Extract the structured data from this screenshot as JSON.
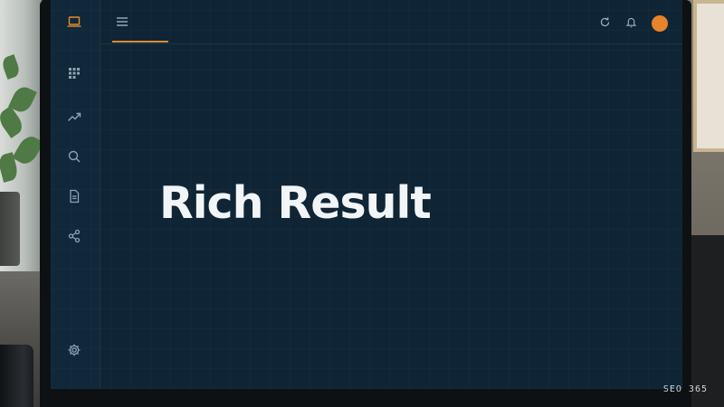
{
  "sidebar": {
    "logo_icon": "laptop-icon",
    "items": [
      {
        "name": "dashboard",
        "icon": "grid-icon"
      },
      {
        "name": "trends",
        "icon": "trending-up-icon"
      },
      {
        "name": "search",
        "icon": "search-icon"
      },
      {
        "name": "documents",
        "icon": "document-icon"
      },
      {
        "name": "share",
        "icon": "share-icon"
      }
    ],
    "settings_icon": "gear-icon"
  },
  "topbar": {
    "menu_icon": "hamburger-menu-icon",
    "right_icons": [
      "refresh-icon",
      "bell-icon"
    ],
    "avatar_color": "#e7832a"
  },
  "main": {
    "headline": "Rich Result"
  },
  "watermark": "SEO 365",
  "colors": {
    "accent": "#e08a2c",
    "screen_bg": "#0f2535",
    "sidebar_bg": "#10283a",
    "text": "#f2f5f7"
  }
}
